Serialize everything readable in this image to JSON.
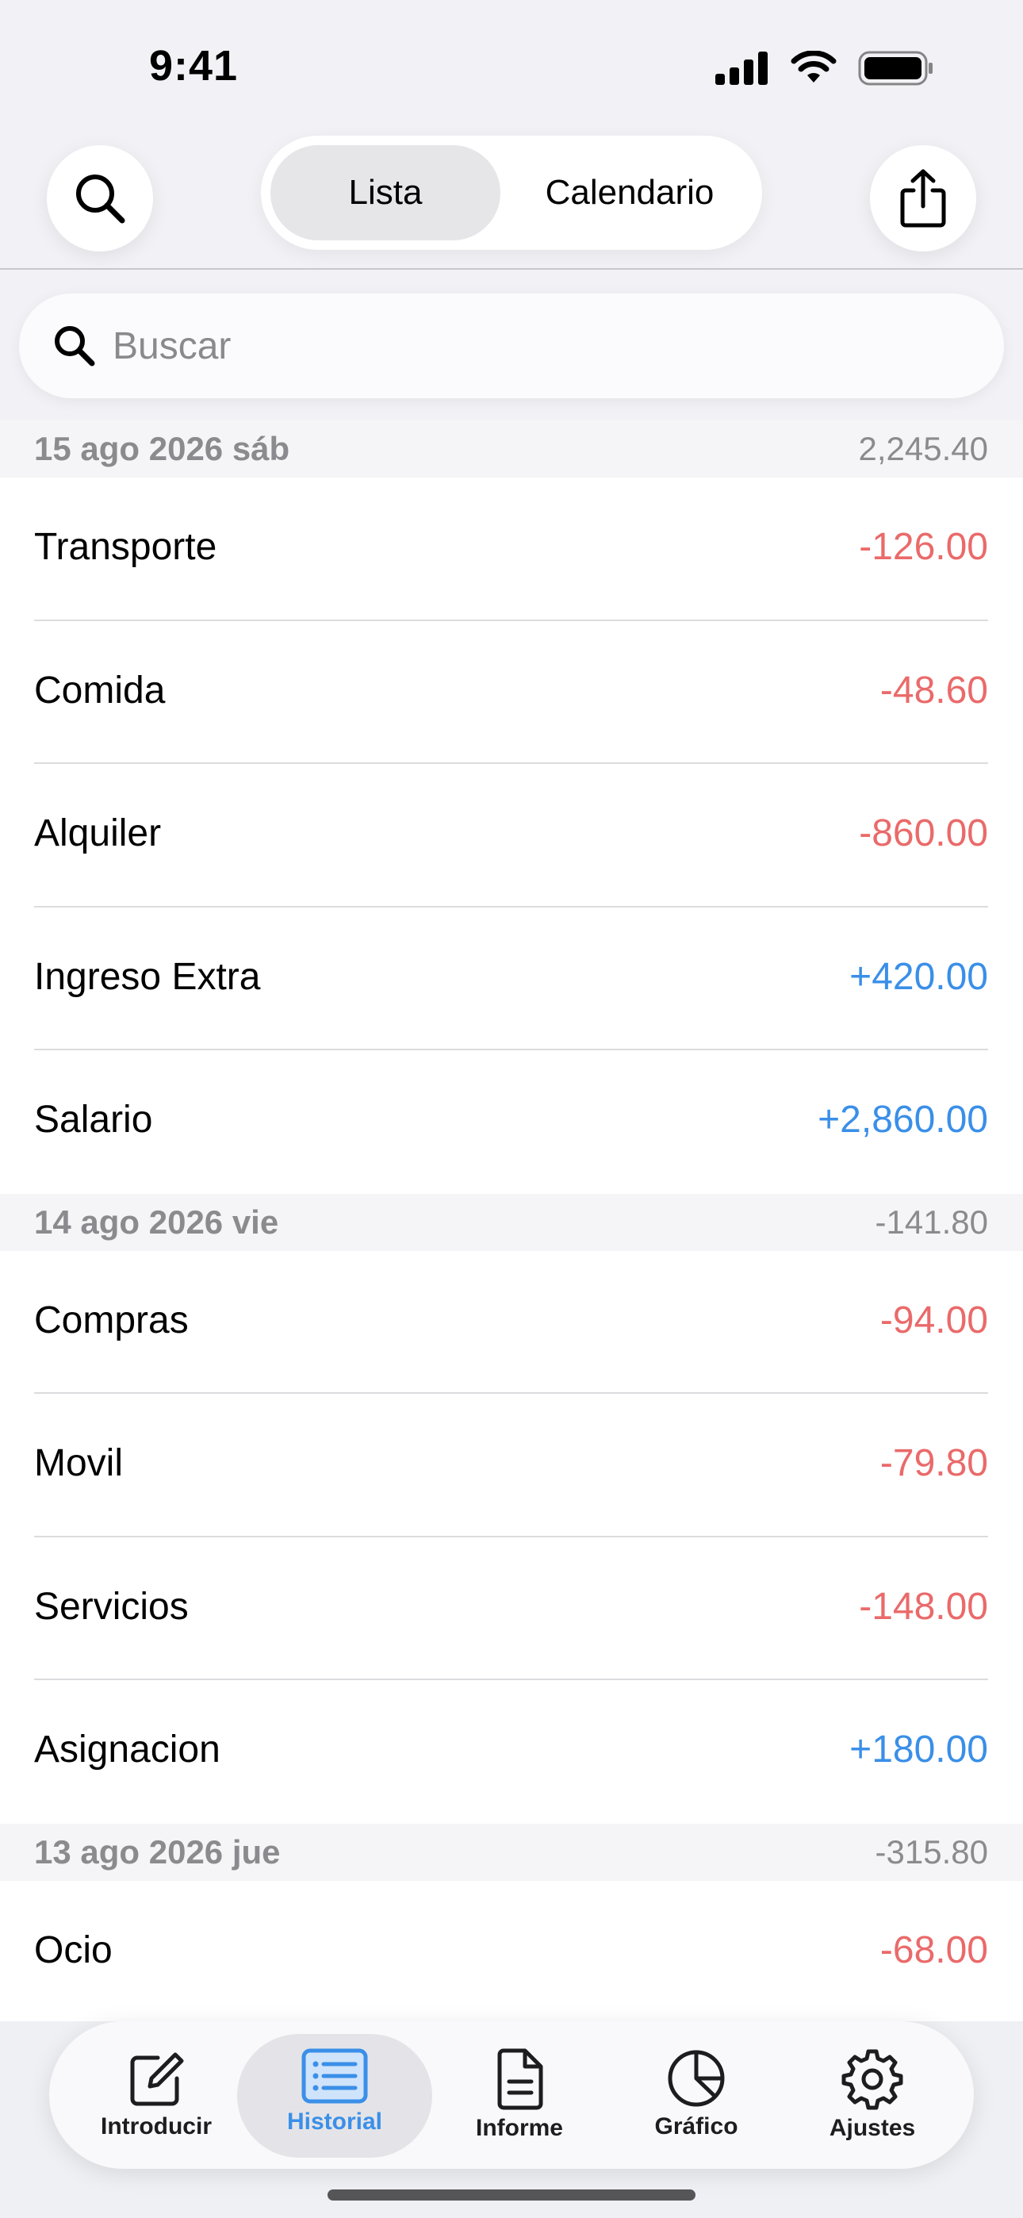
{
  "status": {
    "time": "9:41"
  },
  "header": {
    "segments": [
      {
        "label": "Lista",
        "selected": true
      },
      {
        "label": "Calendario",
        "selected": false
      }
    ]
  },
  "search": {
    "placeholder": "Buscar"
  },
  "groups": [
    {
      "date": "15 ago 2026 sáb",
      "total": "2,245.40",
      "items": [
        {
          "label": "Transporte",
          "amount": "-126.00",
          "kind": "neg"
        },
        {
          "label": "Comida",
          "amount": "-48.60",
          "kind": "neg"
        },
        {
          "label": "Alquiler",
          "amount": "-860.00",
          "kind": "neg"
        },
        {
          "label": "Ingreso Extra",
          "amount": "+420.00",
          "kind": "pos"
        },
        {
          "label": "Salario",
          "amount": "+2,860.00",
          "kind": "pos"
        }
      ]
    },
    {
      "date": "14 ago 2026 vie",
      "total": "-141.80",
      "items": [
        {
          "label": "Compras",
          "amount": "-94.00",
          "kind": "neg"
        },
        {
          "label": "Movil",
          "amount": "-79.80",
          "kind": "neg"
        },
        {
          "label": "Servicios",
          "amount": "-148.00",
          "kind": "neg"
        },
        {
          "label": "Asignacion",
          "amount": "+180.00",
          "kind": "pos"
        }
      ]
    },
    {
      "date": "13 ago 2026 jue",
      "total": "-315.80",
      "items": [
        {
          "label": "Ocio",
          "amount": "-68.00",
          "kind": "neg"
        }
      ]
    }
  ],
  "tabs": [
    {
      "label": "Introducir",
      "icon": "compose-icon",
      "active": false
    },
    {
      "label": "Historial",
      "icon": "list-icon",
      "active": true
    },
    {
      "label": "Informe",
      "icon": "document-icon",
      "active": false
    },
    {
      "label": "Gráfico",
      "icon": "pie-chart-icon",
      "active": false
    },
    {
      "label": "Ajustes",
      "icon": "gear-icon",
      "active": false
    }
  ],
  "colors": {
    "negative": "#ea6a6a",
    "positive": "#3a8fe8",
    "accent": "#3a8fe8"
  }
}
